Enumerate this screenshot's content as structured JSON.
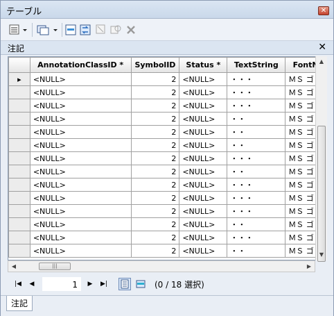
{
  "window": {
    "title": "テーブル",
    "close_glyph": "✕"
  },
  "panel": {
    "label": "注記",
    "close_glyph": "✕"
  },
  "toolbar": {
    "icons": [
      "table-options-icon",
      "related-tables-icon",
      "select-by-attributes-icon",
      "switch-selection-icon",
      "clear-selection-icon",
      "zoom-to-selected-icon",
      "delete-selected-icon"
    ]
  },
  "grid": {
    "columns": [
      "AnnotationClassID *",
      "SymbolID",
      "Status *",
      "TextString",
      "FontN"
    ],
    "rows": [
      [
        "<NULL>",
        "2",
        "<NULL>",
        "・・・",
        "ＭＳ ゴ"
      ],
      [
        "<NULL>",
        "2",
        "<NULL>",
        "・・・",
        "ＭＳ ゴ"
      ],
      [
        "<NULL>",
        "2",
        "<NULL>",
        "・・・",
        "ＭＳ ゴ"
      ],
      [
        "<NULL>",
        "2",
        "<NULL>",
        "・・",
        "ＭＳ ゴ"
      ],
      [
        "<NULL>",
        "2",
        "<NULL>",
        "・・",
        "ＭＳ ゴ"
      ],
      [
        "<NULL>",
        "2",
        "<NULL>",
        "・・",
        "ＭＳ ゴ"
      ],
      [
        "<NULL>",
        "2",
        "<NULL>",
        "・・・",
        "ＭＳ ゴ"
      ],
      [
        "<NULL>",
        "2",
        "<NULL>",
        "・・",
        "ＭＳ ゴ"
      ],
      [
        "<NULL>",
        "2",
        "<NULL>",
        "・・・",
        "ＭＳ ゴ"
      ],
      [
        "<NULL>",
        "2",
        "<NULL>",
        "・・・",
        "ＭＳ ゴ"
      ],
      [
        "<NULL>",
        "2",
        "<NULL>",
        "・・・",
        "ＭＳ ゴ"
      ],
      [
        "<NULL>",
        "2",
        "<NULL>",
        "・・",
        "ＭＳ ゴ"
      ],
      [
        "<NULL>",
        "2",
        "<NULL>",
        "・・・",
        "ＭＳ ゴ"
      ],
      [
        "<NULL>",
        "2",
        "<NULL>",
        "・・",
        "ＭＳ ゴ"
      ]
    ],
    "current_row_marker": "▸"
  },
  "navigation": {
    "first": "|◀",
    "prev": "◀",
    "next": "▶",
    "last": "▶|",
    "record": "1",
    "selection_info": "(0 / 18 選択)"
  },
  "tabs": [
    {
      "label": "注記"
    }
  ]
}
